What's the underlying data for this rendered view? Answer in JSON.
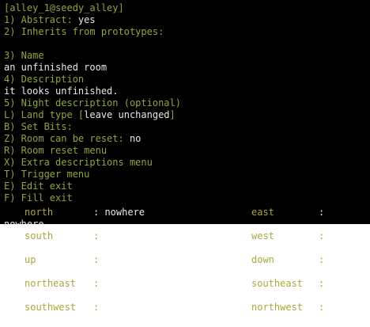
{
  "header": "[alley_1@seedy_alley]",
  "menu": [
    {
      "key": "1) Abstract: ",
      "value": "yes"
    },
    {
      "key": "2) Inherits from prototypes:",
      "value": ""
    },
    {
      "key": "",
      "value": ""
    },
    {
      "key": "3) Name",
      "value": ""
    },
    {
      "key": "",
      "value": "an unfinished room"
    },
    {
      "key": "4) Description",
      "value": ""
    },
    {
      "key": "",
      "value": "it looks unfinished."
    },
    {
      "key": "5) Night description (optional)",
      "value": ""
    },
    {
      "key": "L) Land type [",
      "value": "leave unchanged",
      "suffix": "]"
    },
    {
      "key": "B) Set Bits:",
      "value": ""
    },
    {
      "key": "Z) Room can be reset: ",
      "value": "no"
    },
    {
      "key": "R) Room reset menu",
      "value": ""
    },
    {
      "key": "X) Extra descriptions menu",
      "value": ""
    },
    {
      "key": "T) Trigger menu",
      "value": ""
    },
    {
      "key": "E) Edit exit",
      "value": ""
    },
    {
      "key": "F) Fill exit",
      "value": ""
    }
  ],
  "exits": {
    "north": {
      "label": "north",
      "value": ": nowhere"
    },
    "east": {
      "label": "east",
      "value": ":"
    },
    "overflow": "nowhere",
    "south": {
      "label": "south",
      "value": ":"
    },
    "west": {
      "label": "west",
      "value": ":"
    },
    "up": {
      "label": "up",
      "value": ":"
    },
    "down": {
      "label": "down",
      "value": ":"
    },
    "northeast": {
      "label": "northeast",
      "value": ":"
    },
    "southeast": {
      "label": "southeast",
      "value": ":"
    },
    "southwest": {
      "label": "southwest",
      "value": ":"
    },
    "northwest": {
      "label": "northwest",
      "value": ":"
    }
  },
  "colors": {
    "terminal_bg": "#000000",
    "menu_key": "#8fa63a",
    "menu_value": "#e8e8e8",
    "exit_label": "#a9a83c"
  }
}
